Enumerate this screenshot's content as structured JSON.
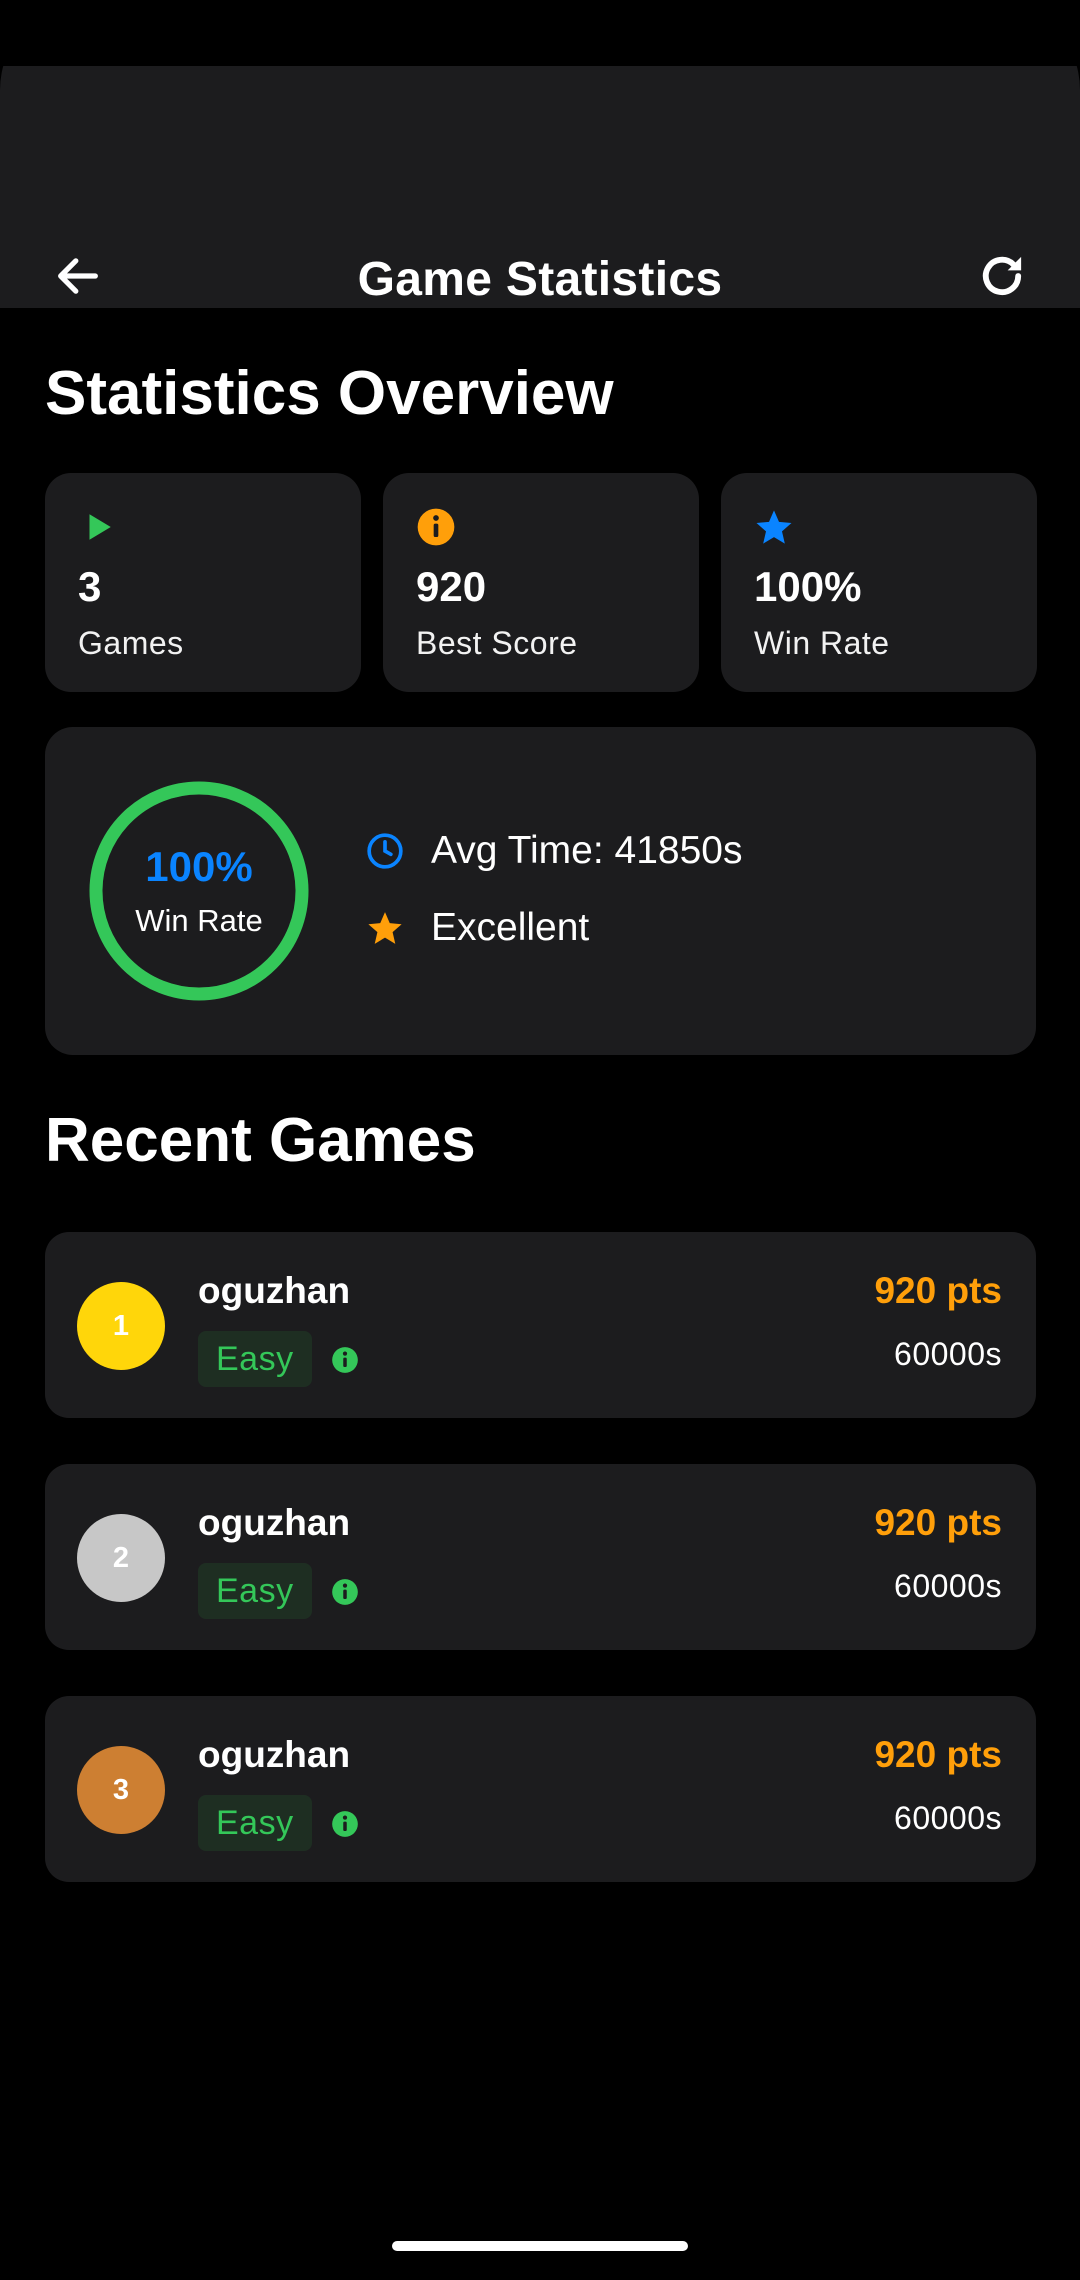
{
  "app": {
    "title": "Game Statistics"
  },
  "overview": {
    "title": "Statistics Overview",
    "cards": [
      {
        "icon": "play-icon",
        "value": "3",
        "label": "Games",
        "color": "#34c759"
      },
      {
        "icon": "info-icon",
        "value": "920",
        "label": "Best Score",
        "color": "#ff9f0a"
      },
      {
        "icon": "star-icon",
        "value": "100%",
        "label": "Win Rate",
        "color": "#0a84ff"
      }
    ]
  },
  "winrate": {
    "percent": "100%",
    "label": "Win Rate",
    "fraction": 1.0,
    "ring_color": "#34c759",
    "avg_time": "Avg Time: 41850s",
    "rating": "Excellent"
  },
  "recent": {
    "title": "Recent Games",
    "games": [
      {
        "rank": "1",
        "player": "oguzhan",
        "difficulty": "Easy",
        "points": "920 pts",
        "time": "60000s",
        "rank_color": "#ffd60a"
      },
      {
        "rank": "2",
        "player": "oguzhan",
        "difficulty": "Easy",
        "points": "920 pts",
        "time": "60000s",
        "rank_color": "#c7c7c7"
      },
      {
        "rank": "3",
        "player": "oguzhan",
        "difficulty": "Easy",
        "points": "920 pts",
        "time": "60000s",
        "rank_color": "#cd7f32"
      }
    ]
  },
  "colors": {
    "background": "#000000",
    "surface": "#1c1c1e",
    "accent_green": "#34c759",
    "accent_orange": "#ff9f0a",
    "accent_blue": "#0a84ff"
  }
}
